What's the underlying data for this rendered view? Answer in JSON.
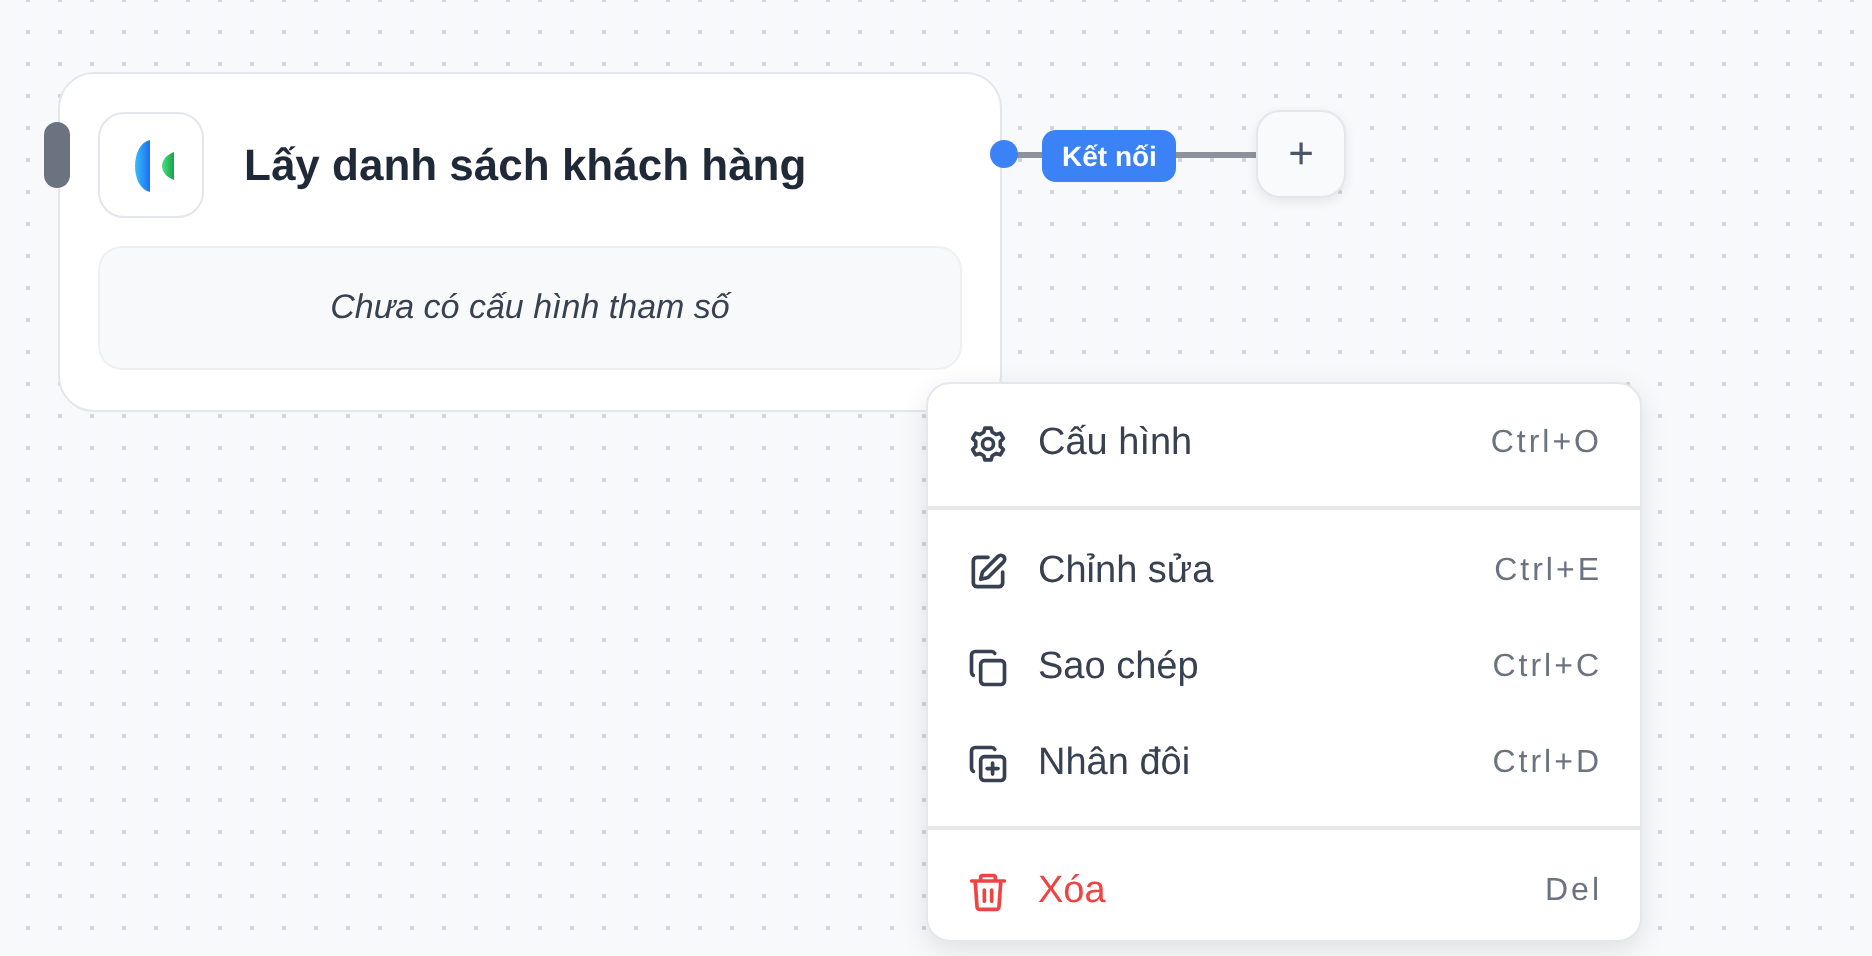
{
  "node": {
    "title": "Lấy danh sách khách hàng",
    "body": "Chưa có cấu hình tham số"
  },
  "connection": {
    "label": "Kết nối",
    "add_button": "+"
  },
  "context_menu": {
    "groups": [
      [
        {
          "label": "Cấu hình",
          "shortcut": "Ctrl+O",
          "kind": "settings"
        }
      ],
      [
        {
          "label": "Chỉnh sửa",
          "shortcut": "Ctrl+E",
          "kind": "edit"
        },
        {
          "label": "Sao chép",
          "shortcut": "Ctrl+C",
          "kind": "copy"
        },
        {
          "label": "Nhân đôi",
          "shortcut": "Ctrl+D",
          "kind": "duplicate"
        }
      ],
      [
        {
          "label": "Xóa",
          "shortcut": "Del",
          "kind": "delete"
        }
      ]
    ]
  }
}
